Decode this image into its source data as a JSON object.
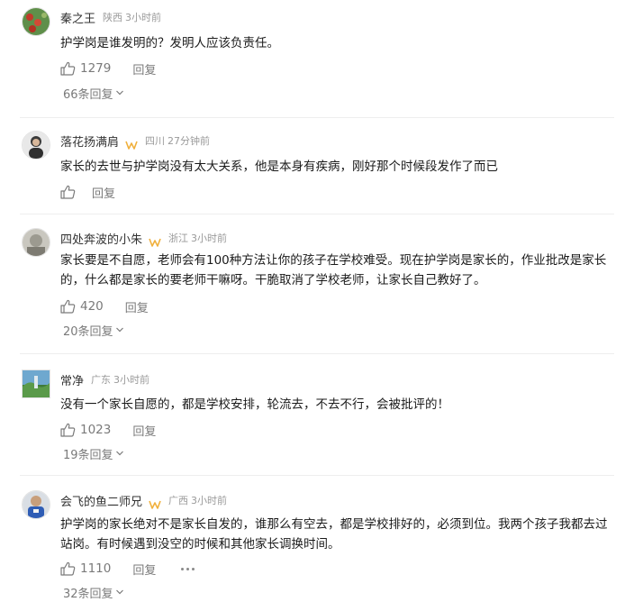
{
  "comments": [
    {
      "name": "秦之王",
      "vip": false,
      "location": "陕西",
      "time": "3小时前",
      "text": "护学岗是谁发明的？发明人应该负责任。",
      "likes": "1279",
      "reply_label": "回复",
      "replies_label": "66条回复"
    },
    {
      "name": "落花扬满肩",
      "vip": true,
      "location": "四川",
      "time": "27分钟前",
      "text": "家长的去世与护学岗没有太大关系，他是本身有疾病，刚好那个时候段发作了而已",
      "likes": "",
      "reply_label": "回复",
      "replies_label": ""
    },
    {
      "name": "四处奔波的小朱",
      "vip": true,
      "location": "浙江",
      "time": "3小时前",
      "text": "家长要是不自愿，老师会有100种方法让你的孩子在学校难受。现在护学岗是家长的，作业批改是家长的，什么都是家长的要老师干嘛呀。干脆取消了学校老师，让家长自己教好了。",
      "likes": "420",
      "reply_label": "回复",
      "replies_label": "20条回复"
    },
    {
      "name": "常净",
      "vip": false,
      "location": "广东",
      "time": "3小时前",
      "text": "没有一个家长自愿的，都是学校安排，轮流去，不去不行，会被批评的！",
      "likes": "1023",
      "reply_label": "回复",
      "replies_label": "19条回复"
    },
    {
      "name": "会飞的鱼二师兄",
      "vip": true,
      "location": "广西",
      "time": "3小时前",
      "text": "护学岗的家长绝对不是家长自发的，谁那么有空去，都是学校排好的，必须到位。我两个孩子我都去过站岗。有时候遇到没空的时候和其他家长调换时间。",
      "likes": "1110",
      "reply_label": "回复",
      "replies_label": "32条回复"
    }
  ],
  "colors": {
    "vip": "#f0b03c",
    "muted": "#9a9a9a",
    "text": "#1a1a1a"
  },
  "icons": {
    "like": "thumbs-up-icon",
    "more": "more-dots-icon",
    "expand": "chevron-down-icon",
    "vip": "vip-badge-icon"
  }
}
